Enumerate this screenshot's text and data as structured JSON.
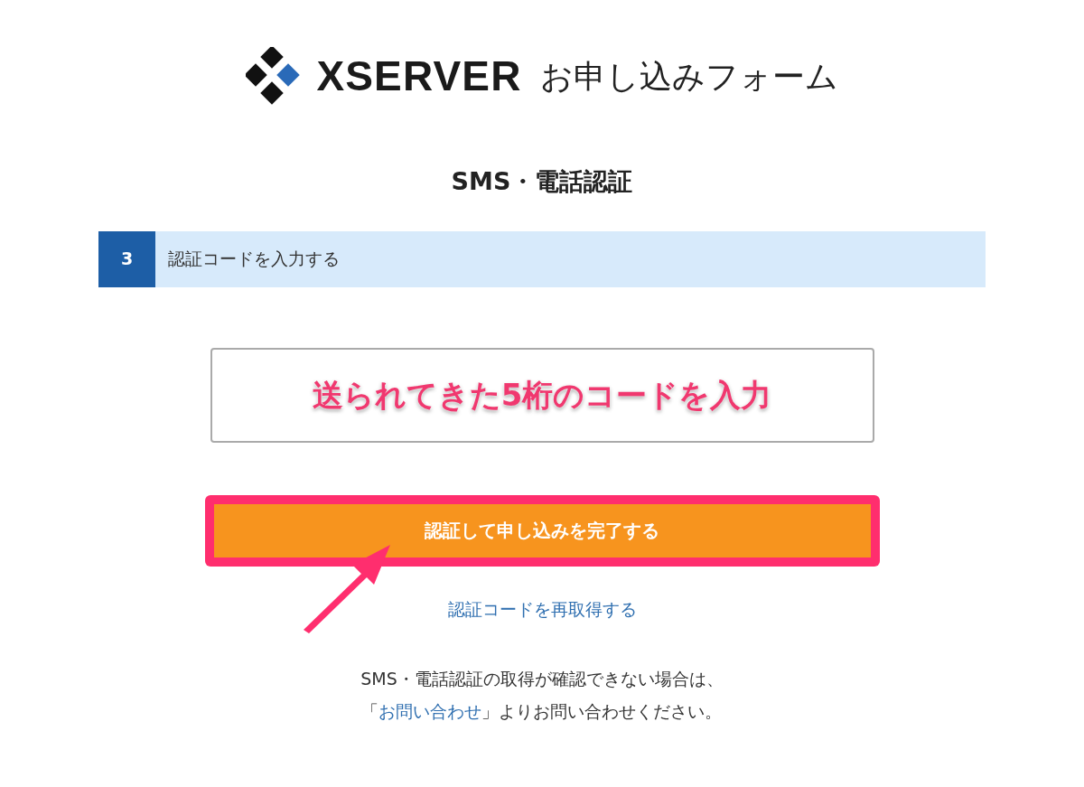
{
  "header": {
    "logo": "XSERVER",
    "title": "お申し込みフォーム"
  },
  "heading": "SMS・電話認証",
  "step": {
    "number": "3",
    "label": "認証コードを入力する"
  },
  "annotation": "送られてきた5桁のコードを入力",
  "submit_button": {
    "label": "認証して申し込みを完了する",
    "highlighted": true
  },
  "resend_link": "認証コードを再取得する",
  "footer": {
    "line1": "SMS・電話認証の取得が確認できない場合は、",
    "open": "「",
    "link": "お問い合わせ",
    "after": "」よりお問い合わせください。"
  }
}
